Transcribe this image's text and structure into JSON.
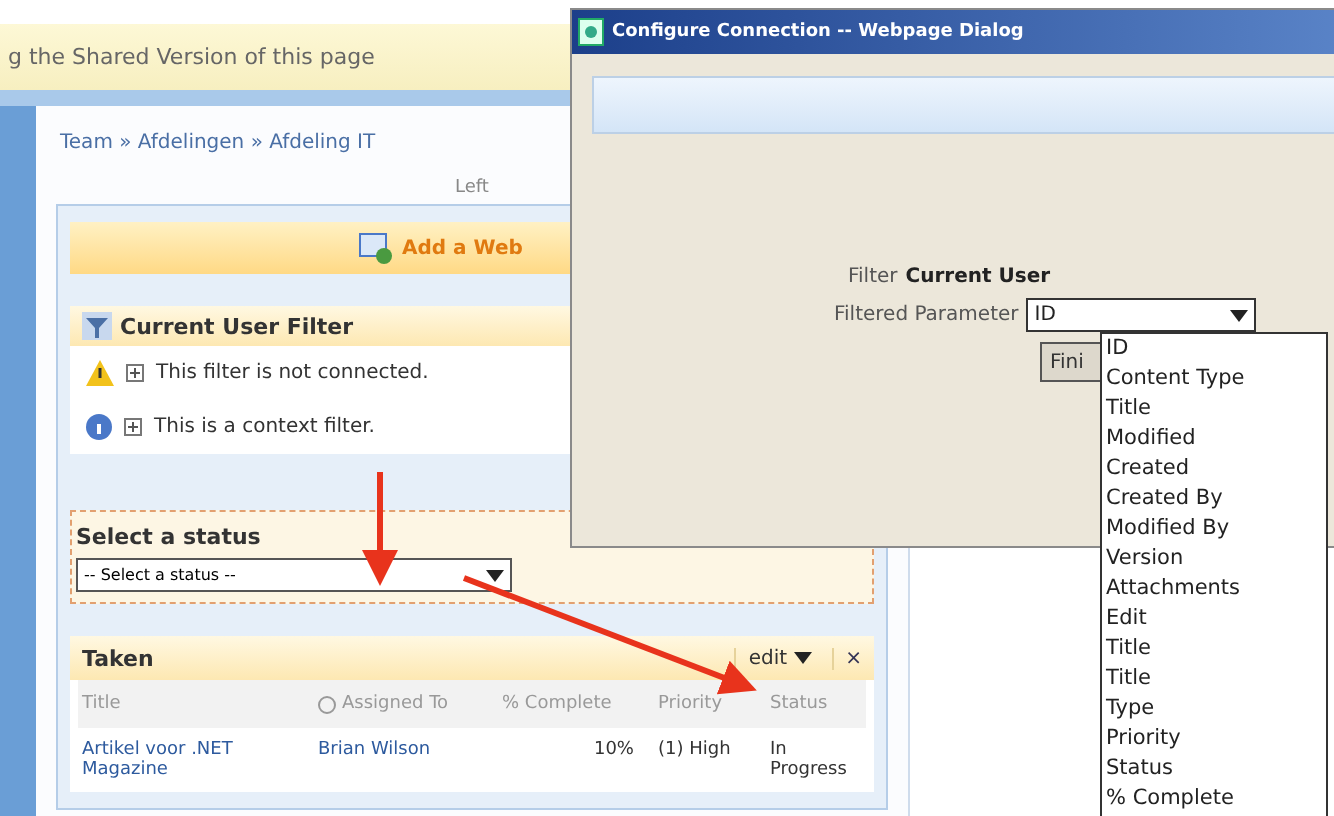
{
  "info_bar": {
    "text": "g the Shared Version of this page"
  },
  "breadcrumb": "Team » Afdelingen » Afdeling IT",
  "zone_label": "Left",
  "add_web_part": "Add a Web",
  "filter_part": {
    "title": "Current User Filter",
    "messages": [
      {
        "kind": "warning",
        "text": "This filter is not connected."
      },
      {
        "kind": "info",
        "text": "This is a context filter."
      }
    ]
  },
  "status_filter": {
    "title": "Select a status",
    "dropdown": {
      "value": "-- Select a status --"
    }
  },
  "tasks": {
    "title": "Taken",
    "edit": "edit",
    "close": "×",
    "columns": [
      "Title",
      "Assigned To",
      "% Complete",
      "Priority",
      "Status"
    ],
    "rows": [
      {
        "title": "Artikel voor .NET Magazine",
        "assigned_to": "Brian Wilson",
        "complete": "10%",
        "priority": "(1) High",
        "status": "In Progress"
      }
    ]
  },
  "dialog": {
    "title": "Configure Connection -- Webpage Dialog",
    "filter_label": "Filter",
    "filter_name": "Current User",
    "parameter_label": "Filtered Parameter",
    "parameter_value": "ID",
    "button": "Fini",
    "options": [
      "ID",
      "Content Type",
      "Title",
      "Modified",
      "Created",
      "Created By",
      "Modified By",
      "Version",
      "Attachments",
      "Edit",
      "Title",
      "Title",
      "Type",
      "Priority",
      "Status",
      "% Complete"
    ]
  }
}
